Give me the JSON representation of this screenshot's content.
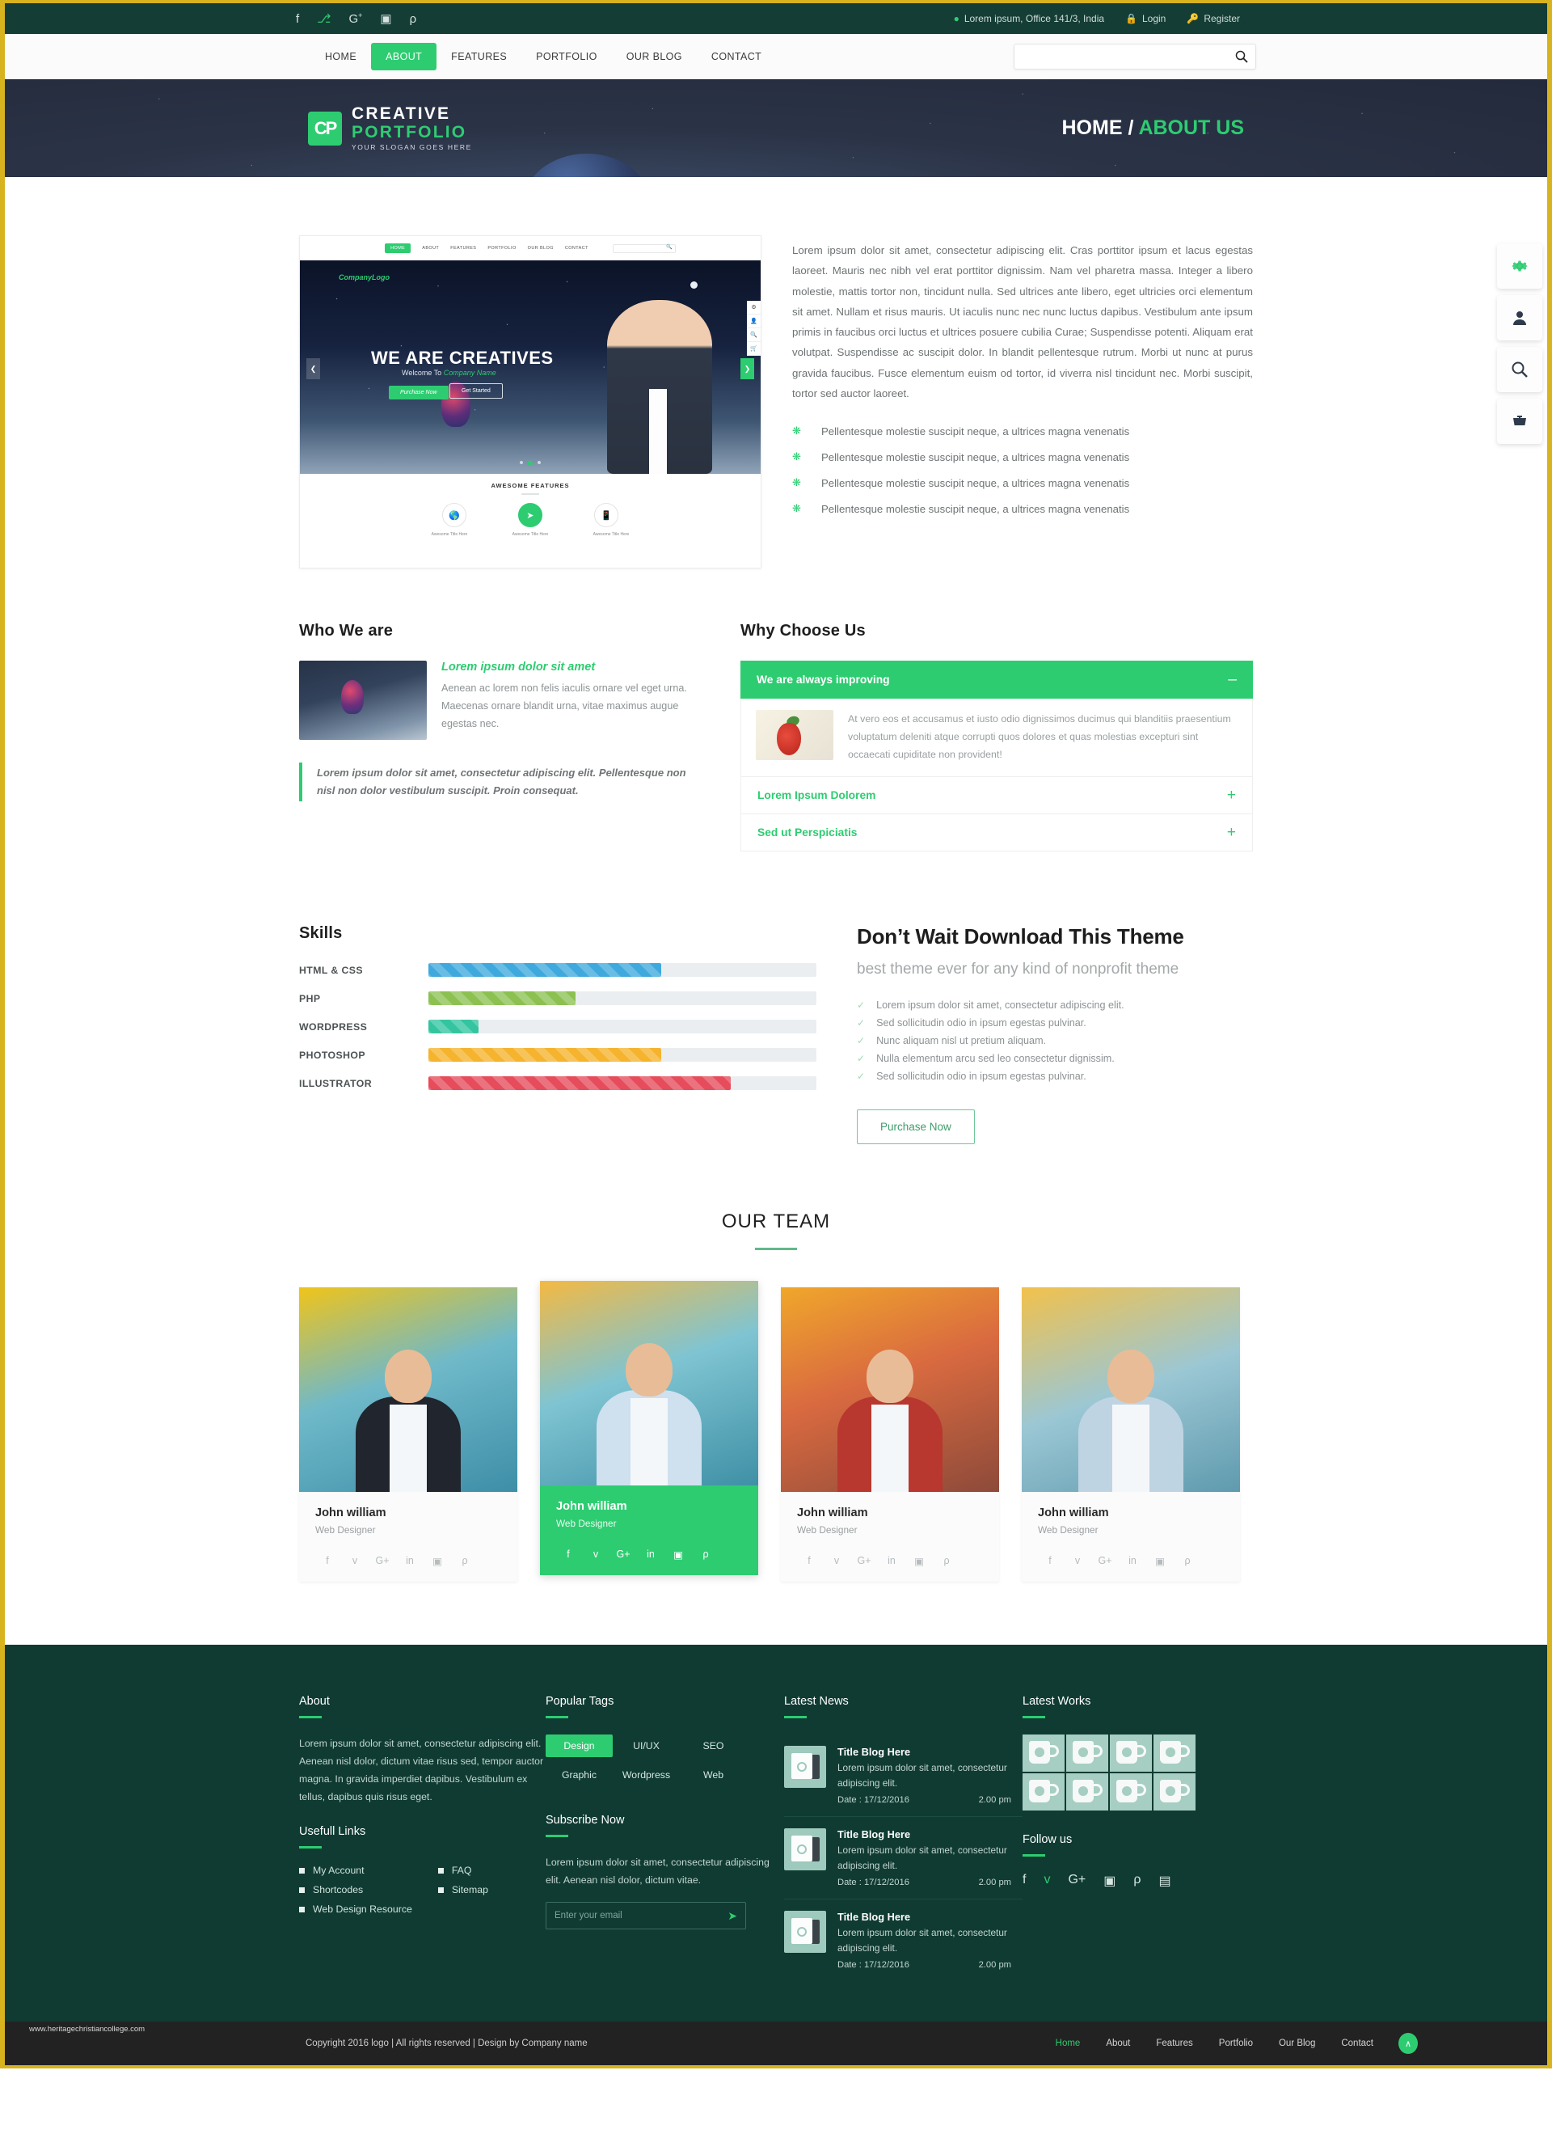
{
  "topbar": {
    "social": [
      {
        "name": "facebook-icon",
        "glyph": "f"
      },
      {
        "name": "twitter-icon",
        "glyph": "ᴠ"
      },
      {
        "name": "google-plus-icon",
        "glyph": "G+"
      },
      {
        "name": "instagram-icon",
        "glyph": "▣"
      },
      {
        "name": "pinterest-icon",
        "glyph": "ρ"
      }
    ],
    "address": "Lorem ipsum, Office 141/3, India",
    "login": "Login",
    "register": "Register"
  },
  "nav": {
    "items": [
      {
        "label": "HOME",
        "active": false
      },
      {
        "label": "ABOUT",
        "active": true
      },
      {
        "label": "FEATURES",
        "active": false
      },
      {
        "label": "PORTFOLIO",
        "active": false
      },
      {
        "label": "OUR BLOG",
        "active": false
      },
      {
        "label": "CONTACT",
        "active": false
      }
    ],
    "search_value": "",
    "search_placeholder": ""
  },
  "hero": {
    "logo_line1": "CREATIVE",
    "logo_line2": "PORTFOLIO",
    "logo_slogan": "YOUR SLOGAN GOES HERE",
    "logo_mark": "CP",
    "breadcrumb_home": "HOME",
    "breadcrumb_sep": "/",
    "breadcrumb_current": "ABOUT US"
  },
  "side_buttons": [
    {
      "name": "gear-icon",
      "glyph": "⚙"
    },
    {
      "name": "user-icon",
      "glyph": "👤"
    },
    {
      "name": "search-icon",
      "glyph": "🔍"
    },
    {
      "name": "basket-icon",
      "glyph": "🗑"
    }
  ],
  "mockup": {
    "nav": [
      "HOME",
      "ABOUT",
      "FEATURES",
      "PORTFOLIO",
      "OUR BLOG",
      "CONTACT"
    ],
    "company_logo": "CompanyLogo",
    "hero_title": "WE ARE CREATIVES",
    "hero_sub_prefix": "Welcome To ",
    "hero_sub_company": "Company Name",
    "btn_purchase": "Purchase Now",
    "btn_started": "Get Started",
    "features_title": "AWESOME FEATURES",
    "feature_labels": [
      "Awesome Title Here",
      "Awesome Title Here",
      "Awesome Title Here"
    ]
  },
  "intro": {
    "paragraph": "Lorem ipsum dolor sit amet, consectetur adipiscing elit. Cras porttitor ipsum et lacus egestas laoreet. Mauris nec nibh vel erat porttitor dignissim. Nam vel pharetra massa. Integer a libero molestie, mattis tortor non, tincidunt nulla. Sed ultrices ante libero, eget ultricies orci elementum sit amet. Nullam et risus mauris. Ut iaculis nunc nec nunc luctus dapibus. Vestibulum ante ipsum primis in faucibus orci luctus et ultrices posuere cubilia Curae; Suspendisse potenti. Aliquam erat volutpat. Suspendisse ac suscipit dolor. In blandit pellentesque rutrum. Morbi ut nunc at purus gravida faucibus. Fusce elementum euism od tortor, id viverra nisl tincidunt nec. Morbi suscipit, tortor sed auctor laoreet.",
    "list": [
      "Pellentesque molestie suscipit neque, a ultrices magna venenatis",
      "Pellentesque molestie suscipit neque, a ultrices magna venenatis",
      "Pellentesque molestie suscipit neque, a ultrices magna venenatis",
      "Pellentesque molestie suscipit neque, a ultrices magna venenatis"
    ]
  },
  "who": {
    "title": "Who We are",
    "sub_title": "Lorem ipsum dolor sit amet",
    "sub_text": "Aenean ac lorem non felis iaculis ornare vel eget urna. Maecenas ornare blandit urna, vitae maximus augue egestas nec.",
    "quote": "Lorem ipsum dolor sit amet, consectetur adipiscing elit. Pellentesque non nisl non dolor vestibulum suscipit. Proin consequat."
  },
  "why": {
    "title": "Why Choose Us",
    "open_item": {
      "label": "We are always improving",
      "sign": "–",
      "body": "At vero eos et accusamus et iusto odio dignissimos ducimus qui blanditiis praesentium voluptatum deleniti atque corrupti quos dolores et quas molestias excepturi sint occaecati cupiditate non provident!"
    },
    "closed_items": [
      {
        "label": "Lorem Ipsum Dolorem",
        "sign": "+"
      },
      {
        "label": "Sed ut Perspiciatis",
        "sign": "+"
      }
    ]
  },
  "skills": {
    "title": "Skills",
    "items": [
      {
        "name": "HTML & CSS",
        "percent": 60,
        "color": "#3fa9dd"
      },
      {
        "name": "PHP",
        "percent": 38,
        "color": "#8cc152"
      },
      {
        "name": "WORDPRESS",
        "percent": 13,
        "color": "#34c5a0"
      },
      {
        "name": "PHOTOSHOP",
        "percent": 60,
        "color": "#f5b32e"
      },
      {
        "name": "ILLUSTRATOR",
        "percent": 78,
        "color": "#e64c5b"
      }
    ]
  },
  "theme": {
    "heading": "Don’t Wait Download This Theme",
    "subheading": "best theme ever for any kind of nonprofit theme",
    "bullets": [
      "Lorem ipsum dolor sit amet, consectetur adipiscing elit.",
      "Sed sollicitudin odio in ipsum egestas pulvinar.",
      "Nunc aliquam nisl ut pretium aliquam.",
      "Nulla elementum arcu sed leo consectetur dignissim.",
      "Sed sollicitudin odio in ipsum egestas pulvinar."
    ],
    "button": "Purchase Now"
  },
  "team": {
    "title": "OUR TEAM",
    "members": [
      {
        "name": "John william",
        "role": "Web Designer",
        "featured": false
      },
      {
        "name": "John william",
        "role": "Web Designer",
        "featured": true
      },
      {
        "name": "John william",
        "role": "Web Designer",
        "featured": false
      },
      {
        "name": "John william",
        "role": "Web Designer",
        "featured": false
      }
    ],
    "social": [
      "f",
      "ᴠ",
      "G+",
      "in",
      "▣",
      "ρ"
    ]
  },
  "footer": {
    "about": {
      "title": "About",
      "text": "Lorem ipsum dolor sit amet, consectetur adipiscing elit. Aenean nisl dolor, dictum vitae risus sed, tempor auctor magna. In gravida imperdiet dapibus. Vestibulum ex tellus, dapibus quis risus eget."
    },
    "useful_links": {
      "title": "Usefull Links",
      "col1": [
        "My Account",
        "Shortcodes",
        "Web Design Resource"
      ],
      "col2": [
        "FAQ",
        "Sitemap"
      ]
    },
    "tags": {
      "title": "Popular Tags",
      "items": [
        {
          "label": "Design",
          "active": true
        },
        {
          "label": "UI/UX",
          "active": false
        },
        {
          "label": "SEO",
          "active": false
        },
        {
          "label": "Graphic",
          "active": false
        },
        {
          "label": "Wordpress",
          "active": false
        },
        {
          "label": "Web",
          "active": false
        }
      ]
    },
    "subscribe": {
      "title": "Subscribe Now",
      "text": "Lorem ipsum dolor sit amet, consectetur adipiscing elit. Aenean nisl dolor, dictum vitae.",
      "placeholder": "Enter your email",
      "value": ""
    },
    "news": {
      "title": "Latest News",
      "items": [
        {
          "title": "Title Blog Here",
          "desc": "Lorem ipsum dolor sit amet, consectetur adipiscing elit.",
          "date": "Date : 17/12/2016",
          "time": "2.00 pm"
        },
        {
          "title": "Title Blog Here",
          "desc": "Lorem ipsum dolor sit amet, consectetur adipiscing elit.",
          "date": "Date : 17/12/2016",
          "time": "2.00 pm"
        },
        {
          "title": "Title Blog Here",
          "desc": "Lorem ipsum dolor sit amet, consectetur adipiscing elit.",
          "date": "Date : 17/12/2016",
          "time": "2.00 pm"
        }
      ]
    },
    "works": {
      "title": "Latest Works",
      "count": 8
    },
    "follow": {
      "title": "Follow us",
      "icons": [
        "f",
        "ᴠ",
        "G+",
        "▣",
        "ρ",
        "▤"
      ]
    }
  },
  "bottom": {
    "url": "www.heritagechristiancollege.com",
    "copyright": "Copyright 2016 logo  |  All rights reserved  |  Design by Company name",
    "nav": [
      {
        "label": "Home",
        "active": true
      },
      {
        "label": "About",
        "active": false
      },
      {
        "label": "Features",
        "active": false
      },
      {
        "label": "Portfolio",
        "active": false
      },
      {
        "label": "Our Blog",
        "active": false
      },
      {
        "label": "Contact",
        "active": false
      }
    ],
    "to_top": "∧"
  }
}
